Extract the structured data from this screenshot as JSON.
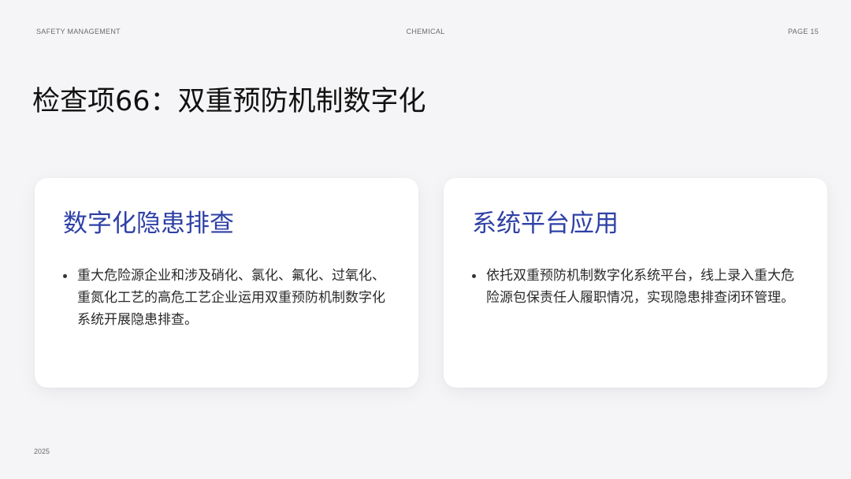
{
  "header": {
    "left": "SAFETY MANAGEMENT",
    "center": "CHEMICAL",
    "right": "PAGE 15"
  },
  "title": "检查项66：双重预防机制数字化",
  "cards": [
    {
      "title": "数字化隐患排查",
      "bullet": "重大危险源企业和涉及硝化、氯化、氟化、过氧化、重氮化工艺的高危工艺企业运用双重预防机制数字化系统开展隐患排查。"
    },
    {
      "title": "系统平台应用",
      "bullet": "依托双重预防机制数字化系统平台，线上录入重大危险源包保责任人履职情况，实现隐患排查闭环管理。"
    }
  ],
  "footer": {
    "year": "2025"
  },
  "colors": {
    "accent": "#2f41a6",
    "background": "#f5f5f7",
    "card": "#ffffff"
  }
}
